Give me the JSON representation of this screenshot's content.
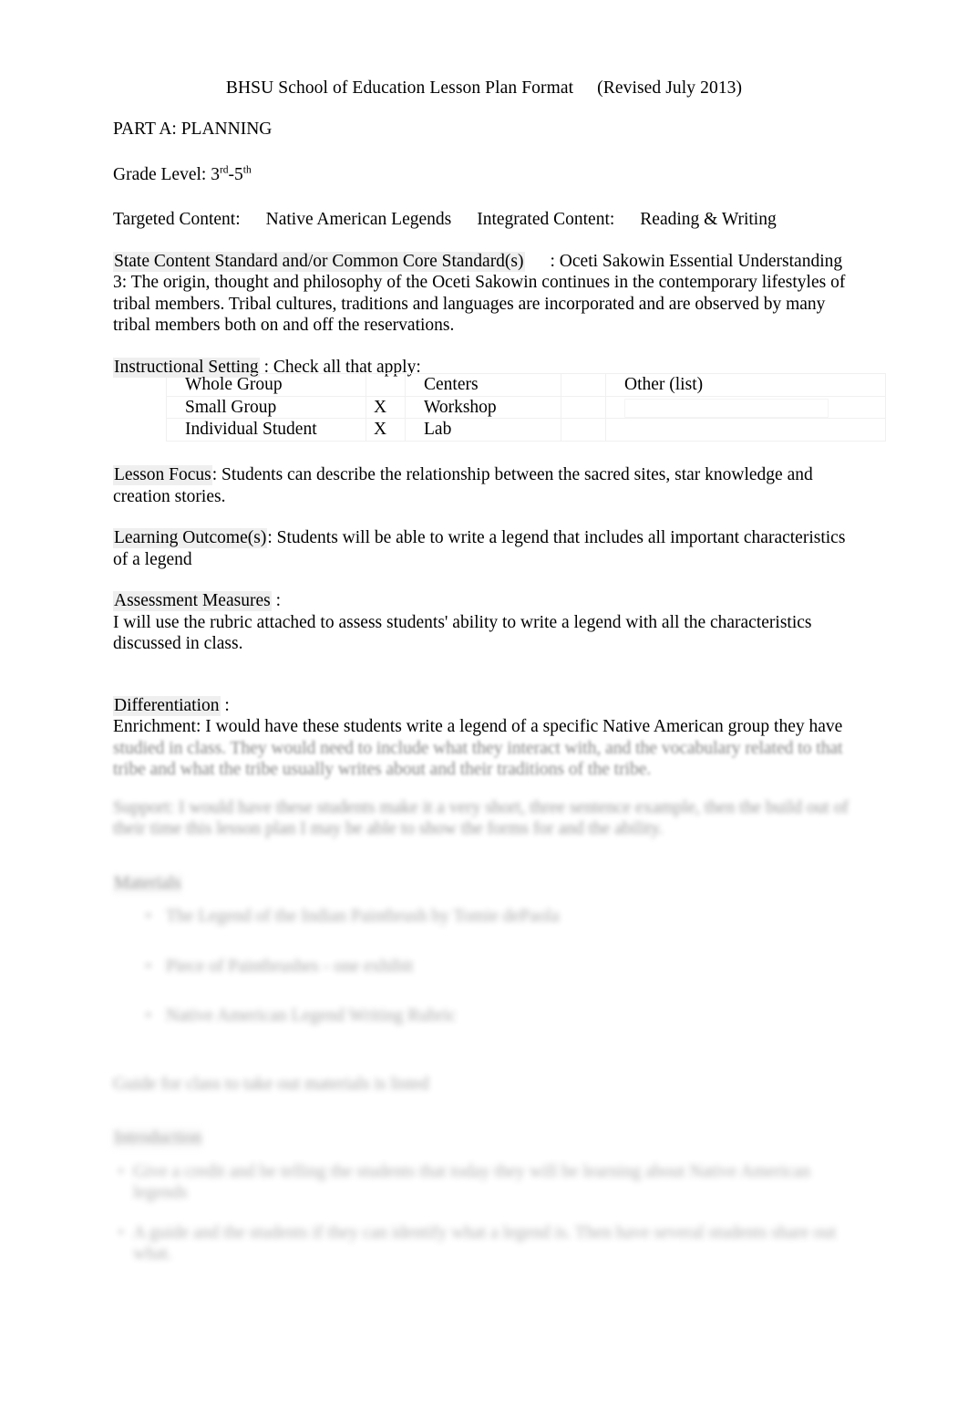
{
  "document": {
    "header_title": "BHSU School of Education Lesson Plan Format",
    "header_revision": "(Revised July 2013)",
    "part_heading": "PART A: PLANNING"
  },
  "grade_level": {
    "label": "Grade Level: 3",
    "sup1": "rd",
    "dash": "-5",
    "sup2": "th"
  },
  "content_row": {
    "targeted_label": "Targeted Content:",
    "targeted_value": "Native American Legends",
    "integrated_label": "Integrated Content:",
    "integrated_value": "Reading & Writing"
  },
  "standard": {
    "label": "State Content Standard and/or Common Core Standard(s)",
    "colon": ": Oceti Sakowin Essential Understanding",
    "body": "3: The origin, thought and philosophy of the Oceti Sakowin continues in the contemporary lifestyles of tribal members. Tribal cultures, traditions and languages are incorporated and are observed by many tribal members both on and off the reservations."
  },
  "instructional_setting": {
    "label": "Instructional Setting",
    "instruction": ": Check all that apply:",
    "rows": [
      {
        "setting": "Whole Group",
        "mark": "",
        "setting2": "Centers",
        "mark2": "",
        "other": "Other (list)"
      },
      {
        "setting": "Small Group",
        "mark": "X",
        "setting2": "Workshop",
        "mark2": "",
        "other": ""
      },
      {
        "setting": "Individual Student",
        "mark": "X",
        "setting2": "Lab",
        "mark2": "",
        "other": ""
      }
    ]
  },
  "lesson_focus": {
    "label": "Lesson Focus",
    "value": ": Students can describe the relationship between the sacred sites, star knowledge and creation stories."
  },
  "learning_outcomes": {
    "label": "Learning Outcome(s)",
    "value": ": Students will be able to write a legend that includes all important characteristics of a legend"
  },
  "assessment_measures": {
    "label": "Assessment Measures",
    "colon": ":",
    "value": "I will use the rubric attached to assess students' ability to write a legend with all the characteristics discussed in class."
  },
  "differentiation": {
    "label": "Differentiation",
    "colon": ":",
    "enrichment": "Enrichment: I would have these students write a legend of a specific Native American group they have",
    "enrichment_rest": "studied in class. They would need to include what they interact with, and the vocabulary related to that tribe and what the tribe usually writes about and their traditions of the tribe.",
    "support": "Support: I would have these students make it a very short, three sentence example, then the build out of their time this lesson plan I may be able to show the forms for and the ability."
  },
  "materials": {
    "label": "Materials",
    "items": [
      "The Legend of the Indian Paintbrush by Tomie dePaola",
      "Piece of Paintbrushes - one exhibit",
      "Native American Legend Writing Rubric"
    ],
    "note": "Guide for class to take out materials is listed"
  },
  "introduction": {
    "label": "Introduction",
    "items": [
      "Give a credit and be telling the students that today they will be learning about Native American legends",
      "A guide and the students if they can identify what a legend is. Then have several students share out what."
    ]
  }
}
